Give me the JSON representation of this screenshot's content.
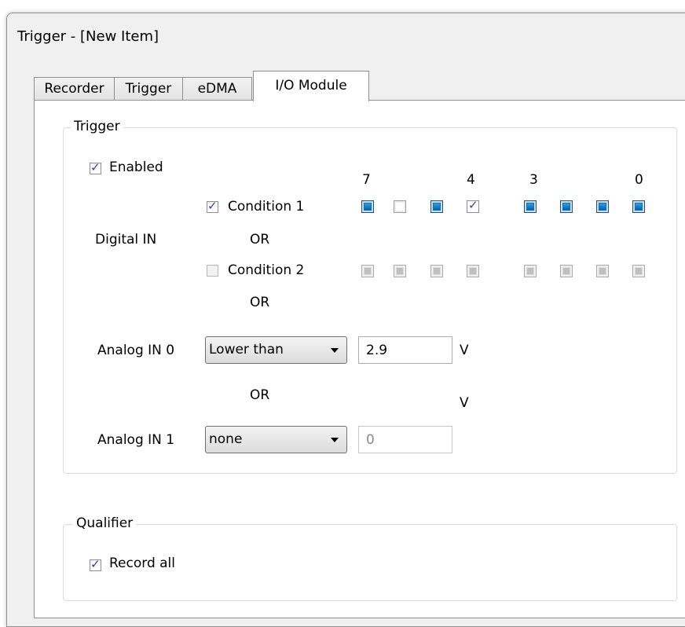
{
  "window": {
    "title": "Trigger - [New Item]"
  },
  "tabs": [
    {
      "label": "Recorder",
      "active": false
    },
    {
      "label": "Trigger",
      "active": false
    },
    {
      "label": "eDMA",
      "active": false
    },
    {
      "label": "I/O Module",
      "active": true
    }
  ],
  "trigger_group": {
    "legend": "Trigger",
    "enabled": {
      "label": "Enabled",
      "checked": true
    },
    "bit_numbers": [
      "7",
      "4",
      "3",
      "0"
    ],
    "digital_in_label": "Digital IN",
    "condition1": {
      "label": "Condition 1",
      "checked": true,
      "bits": [
        "on",
        "off",
        "on",
        "checked",
        "on",
        "on",
        "on",
        "on"
      ]
    },
    "or_1": "OR",
    "condition2": {
      "label": "Condition 2",
      "checked": false,
      "bits": [
        "disabled",
        "disabled",
        "disabled",
        "disabled",
        "disabled",
        "disabled",
        "disabled",
        "disabled"
      ]
    },
    "or_2": "OR",
    "analog0": {
      "label": "Analog IN 0",
      "mode": "Lower than",
      "value": "2.9",
      "unit": "V"
    },
    "or_3": "OR",
    "analog1": {
      "label": "Analog IN 1",
      "mode": "none",
      "value": "0",
      "unit": "V"
    }
  },
  "qualifier_group": {
    "legend": "Qualifier",
    "record_all": {
      "label": "Record all",
      "checked": true
    }
  }
}
